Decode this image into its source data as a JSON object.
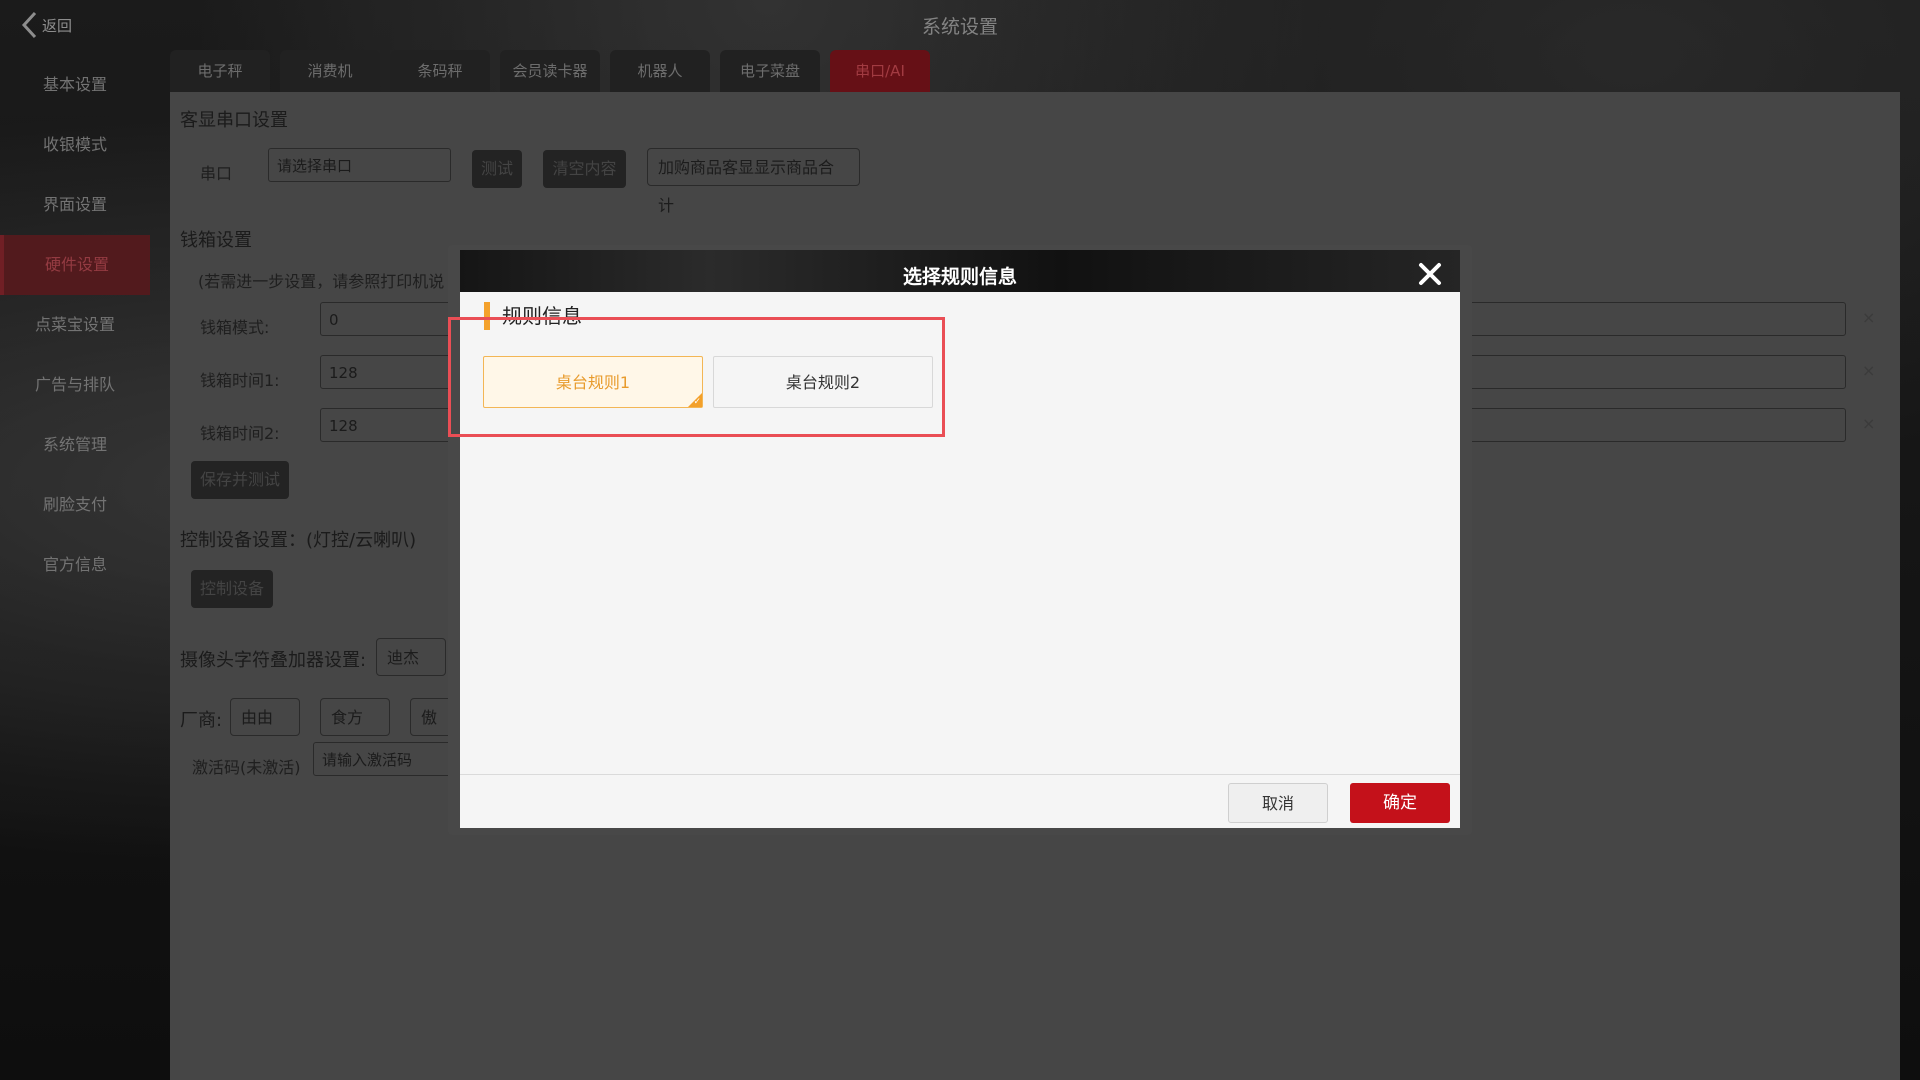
{
  "header": {
    "back_label": "返回",
    "title": "系统设置"
  },
  "sidebar": {
    "items": [
      {
        "label": "基本设置"
      },
      {
        "label": "收银模式"
      },
      {
        "label": "界面设置"
      },
      {
        "label": "硬件设置"
      },
      {
        "label": "点菜宝设置"
      },
      {
        "label": "广告与排队"
      },
      {
        "label": "系统管理"
      },
      {
        "label": "刷脸支付"
      },
      {
        "label": "官方信息"
      }
    ],
    "active": "硬件设置"
  },
  "tabs": {
    "items": [
      {
        "label": "电子秤"
      },
      {
        "label": "消费机"
      },
      {
        "label": "条码秤"
      },
      {
        "label": "会员读卡器"
      },
      {
        "label": "机器人"
      },
      {
        "label": "电子菜盘"
      },
      {
        "label": "串口/AI"
      }
    ],
    "active": "串口/AI"
  },
  "customer_display": {
    "section_title": "客显串口设置",
    "port_label": "串口",
    "port_placeholder": "请选择串口",
    "test_button": "测试",
    "clear_button": "清空内容",
    "option_button": "加购商品客显显示商品合计"
  },
  "cash_drawer": {
    "section_title": "钱箱设置",
    "note": "(若需进一步设置，请参照打印机说",
    "mode_label": "钱箱模式:",
    "mode_value": "0",
    "time1_label": "钱箱时间1:",
    "time1_value": "128",
    "time2_label": "钱箱时间2:",
    "time2_value": "128",
    "save_button": "保存并测试",
    "clear_icon": "×"
  },
  "control_device": {
    "section_title": "控制设备设置：(灯控/云喇叭)",
    "button": "控制设备"
  },
  "camera": {
    "section_title": "摄像头字符叠加器设置:",
    "option": "迪杰"
  },
  "vendor": {
    "label": "厂商:",
    "options": [
      "由由",
      "食方",
      "傲视"
    ],
    "activation_label": "激活码(未激活)",
    "activation_placeholder": "请输入激活码"
  },
  "dialog": {
    "title": "选择规则信息",
    "section_title": "规则信息",
    "rules": [
      {
        "label": "桌台规则1",
        "selected": true
      },
      {
        "label": "桌台规则2",
        "selected": false
      }
    ],
    "cancel_button": "取消",
    "confirm_button": "确定"
  },
  "colors": {
    "accent_red": "#c4111a",
    "selected_orange": "#f3a02a",
    "highlight_red": "#ea4e55"
  }
}
